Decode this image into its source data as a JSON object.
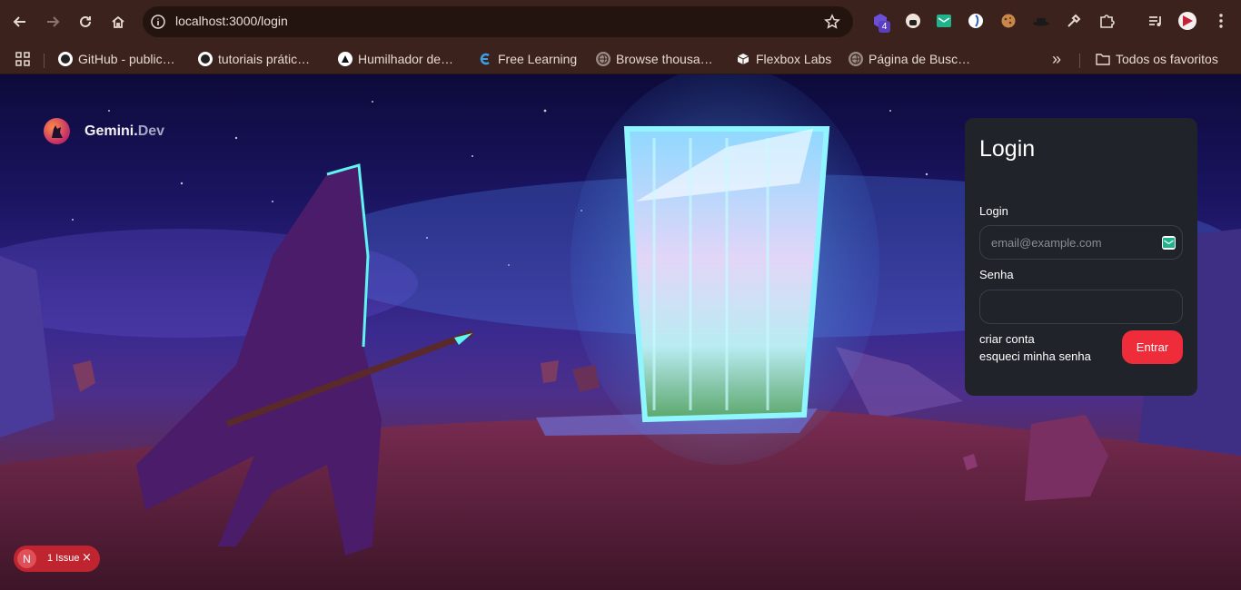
{
  "browser": {
    "url": "localhost:3000/login",
    "extension_badge": "4",
    "bookmarks": [
      {
        "label": "GitHub - public…",
        "icon": "github-icon"
      },
      {
        "label": "tutoriais prátic…",
        "icon": "github-icon"
      },
      {
        "label": "Humilhador de…",
        "icon": "triangle-icon"
      },
      {
        "label": "Free Learning",
        "icon": "free-learning-icon"
      },
      {
        "label": "Browse thousa…",
        "icon": "globe-icon"
      },
      {
        "label": "Flexbox Labs",
        "icon": "cube-icon"
      },
      {
        "label": "Página de Busc…",
        "icon": "globe-icon"
      }
    ],
    "all_bookmarks_label": "Todos os favoritos",
    "chevron_label": "»"
  },
  "brand": {
    "name_main": "Gemini.",
    "name_accent": "Dev"
  },
  "login": {
    "title": "Login",
    "login_label": "Login",
    "email_placeholder": "email@example.com",
    "password_label": "Senha",
    "create_account": "criar conta",
    "forgot_password": "esqueci minha senha",
    "submit_label": "Entrar"
  },
  "dev_overlay": {
    "badge_letter": "N",
    "issue_text": "1 Issue",
    "close_glyph": "×"
  },
  "colors": {
    "accent": "#ee2c3a",
    "card": "#202329",
    "chrome": "#3c221c"
  }
}
